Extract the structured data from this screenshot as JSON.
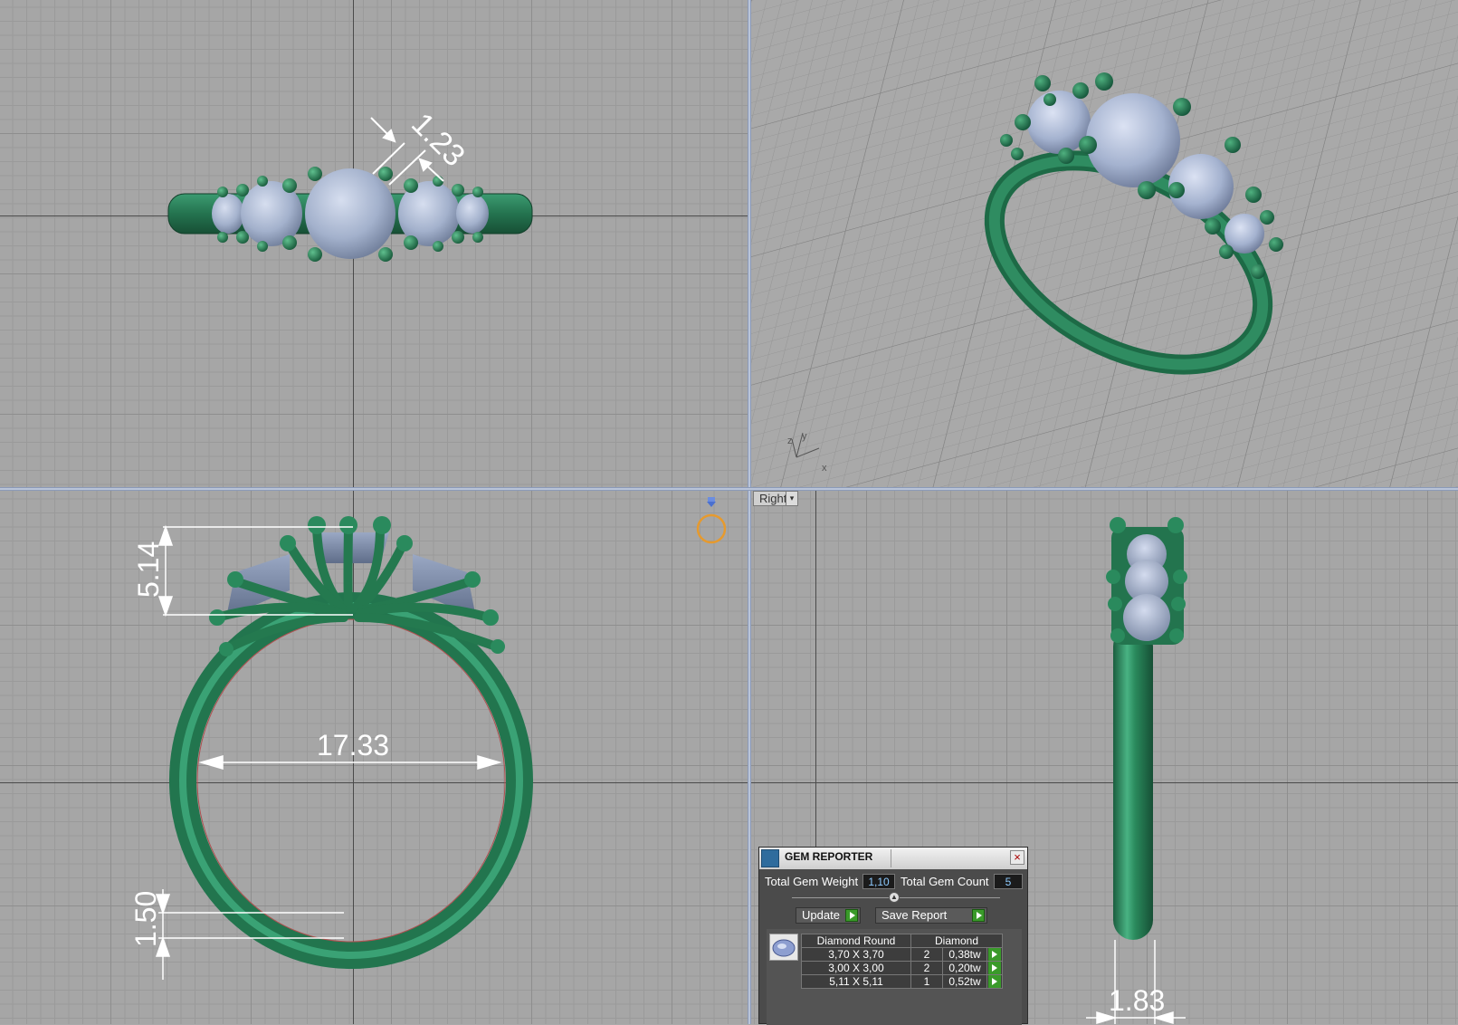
{
  "viewports": {
    "top": {
      "dimension": "1.23"
    },
    "front": {
      "dim_height": "5.14",
      "dim_inner": "17.33",
      "dim_band": "1.50"
    },
    "right": {
      "view_label": "Right",
      "dim_width": "1.83"
    },
    "perspective": {
      "axis_x": "x",
      "axis_y": "y",
      "axis_z": "z"
    }
  },
  "gem_reporter": {
    "title": "GEM REPORTER",
    "total_weight_label": "Total Gem Weight",
    "total_weight_value": "1,10",
    "total_count_label": "Total Gem Count",
    "total_count_value": "5",
    "update_label": "Update",
    "save_report_label": "Save Report",
    "table": {
      "col_shape": "Diamond Round",
      "col_material": "Diamond",
      "rows": [
        {
          "size": "3,70 X 3,70",
          "count": "2",
          "weight": "0,38tw"
        },
        {
          "size": "3,00 X 3,00",
          "count": "2",
          "weight": "0,20tw"
        },
        {
          "size": "5,11 X 5,11",
          "count": "1",
          "weight": "0,52tw"
        }
      ]
    }
  },
  "colors": {
    "metal": "#2e8a62",
    "metal_dark": "#1c5c3e",
    "gem": "#a9b7d2",
    "accent": "#b9c4d8"
  },
  "icons": [
    "gem-reporter-logo-icon",
    "close-icon",
    "play-arrow-icon",
    "dropdown-arrow-icon",
    "ring-cursor-icon"
  ]
}
